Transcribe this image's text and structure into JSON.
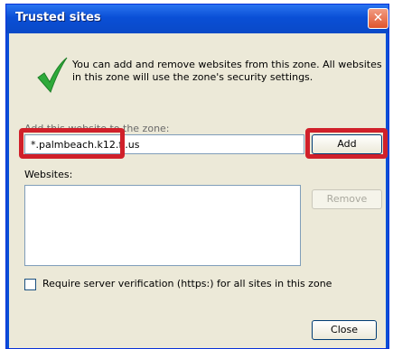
{
  "window": {
    "title": "Trusted sites",
    "close_glyph": "✕"
  },
  "description": "You can add and remove websites from this zone. All websites in this zone will use the zone's security settings.",
  "add_field": {
    "label": "Add this website to the zone:",
    "value": "*.palmbeach.k12.fl.us"
  },
  "buttons": {
    "add": "Add",
    "remove": "Remove",
    "close": "Close"
  },
  "websites": {
    "label": "Websites:",
    "items": []
  },
  "require_https": {
    "label": "Require server verification (https:) for all sites in this zone",
    "checked": false
  },
  "icons": {
    "check": "checkmark-icon"
  },
  "colors": {
    "titlebar": "#0a4fd6",
    "highlight": "#d0202a",
    "check": "#2eaa3a"
  }
}
